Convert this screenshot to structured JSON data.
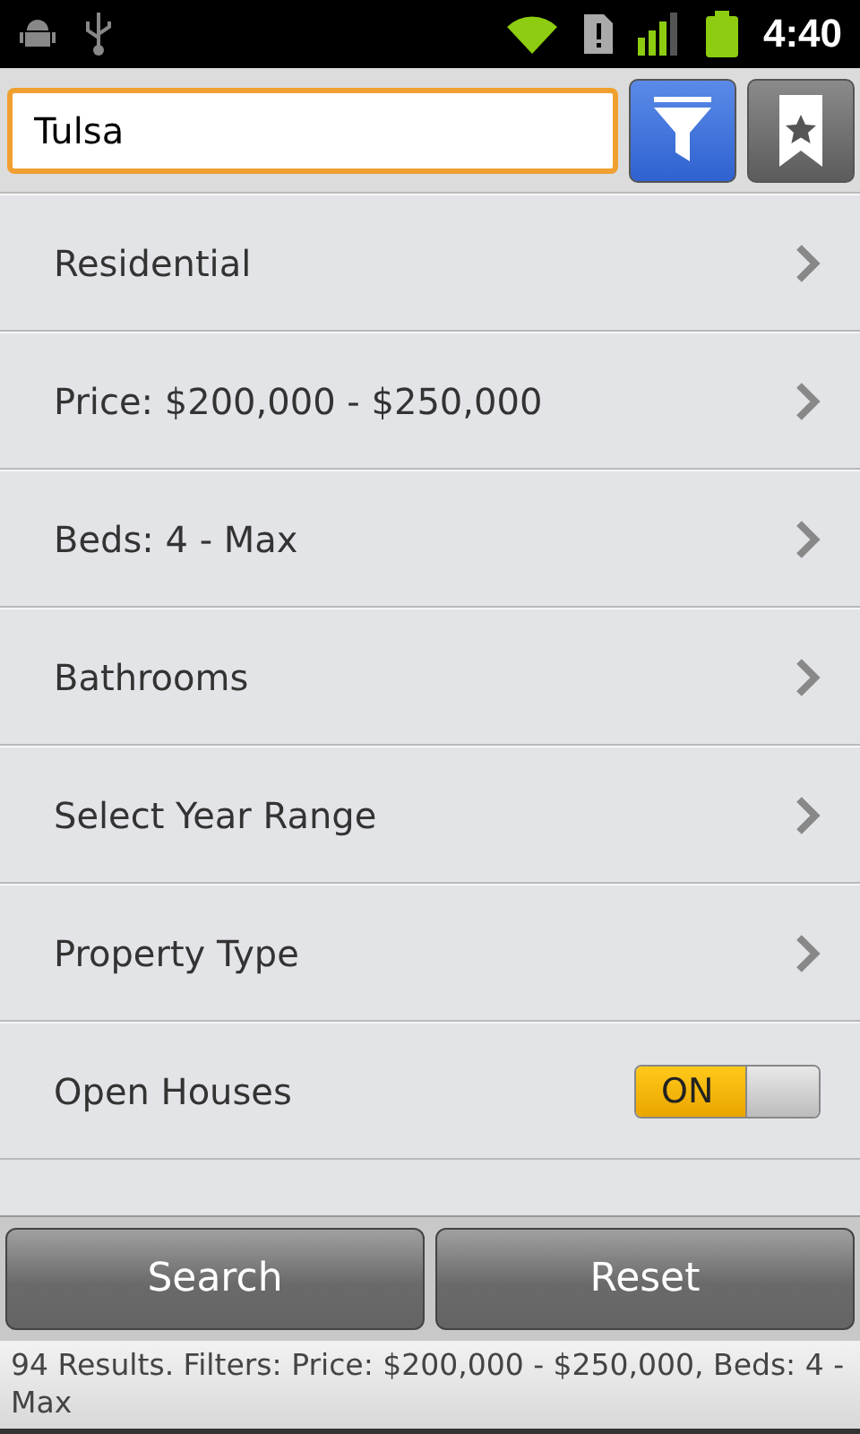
{
  "status_bar": {
    "time": "4:40"
  },
  "search": {
    "value": "Tulsa"
  },
  "filters": [
    {
      "kind": "nav",
      "label": "Residential"
    },
    {
      "kind": "nav",
      "label": "Price: $200,000 - $250,000"
    },
    {
      "kind": "nav",
      "label": "Beds: 4 - Max"
    },
    {
      "kind": "nav",
      "label": "Bathrooms"
    },
    {
      "kind": "nav",
      "label": "Select Year Range"
    },
    {
      "kind": "nav",
      "label": "Property Type"
    },
    {
      "kind": "toggle",
      "label": "Open Houses",
      "on": true,
      "toggle_text": "ON"
    }
  ],
  "buttons": [
    "Search",
    "Reset"
  ],
  "summary": "94 Results. Filters: Price: $200,000 - $250,000, Beds: 4 - Max"
}
